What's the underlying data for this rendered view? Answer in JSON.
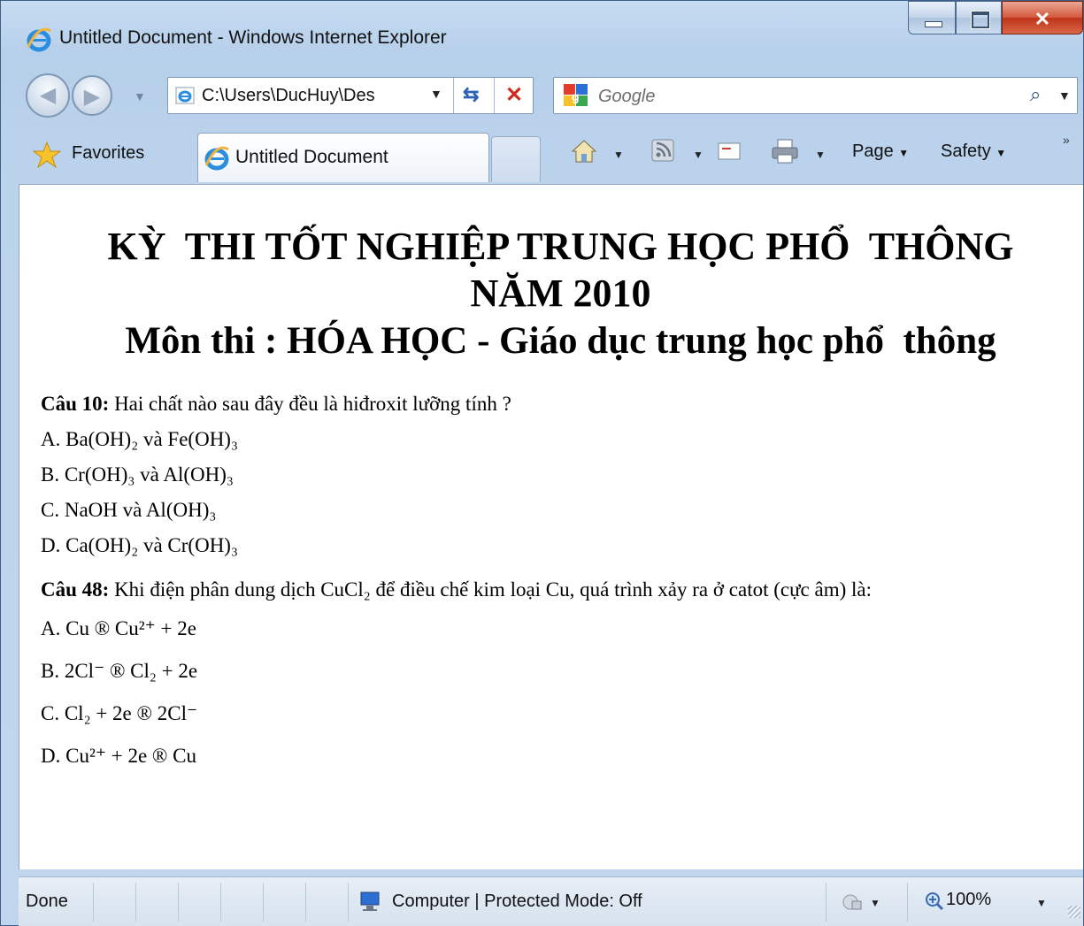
{
  "window": {
    "title": "Untitled Document - Windows Internet Explorer"
  },
  "address": {
    "url": "C:\\Users\\DucHuy\\Des"
  },
  "search": {
    "placeholder": "Google"
  },
  "tabs": {
    "favorites_label": "Favorites",
    "active_tab_label": "Untitled Document"
  },
  "commands": {
    "page_label": "Page",
    "safety_label": "Safety"
  },
  "document": {
    "heading_line1": "KỲ  THI TỐT NGHIỆP TRUNG HỌC PHỔ  THÔNG",
    "heading_line2": "NĂM 2010",
    "heading_line3": "Môn thi : HÓA HỌC - Giáo dục trung học phổ  thông",
    "q10": {
      "label": "Câu 10:",
      "text": " Hai chất nào sau đây đều là hiđroxit lưỡng tính ?",
      "options": [
        "A. Ba(OH)₂ và Fe(OH)₃",
        "B. Cr(OH)₃ và Al(OH)₃",
        "C. NaOH và Al(OH)₃",
        "D. Ca(OH)₂ và Cr(OH)₃"
      ]
    },
    "q48": {
      "label": "Câu 48:",
      "text": " Khi điện phân dung dịch CuCl₂ để điều chế kim loại Cu, quá trình xảy ra ở catot (cực âm) là:",
      "options": [
        "A. Cu ® Cu²⁺ + 2e",
        "B. 2Cl⁻ ® Cl₂ + 2e",
        "C. Cl₂ + 2e ® 2Cl⁻",
        "D. Cu²⁺ + 2e ® Cu"
      ]
    }
  },
  "status": {
    "text": "Done",
    "zone": "Computer | Protected Mode: Off",
    "zoom": "100%"
  },
  "colors": {
    "frame": "#c1d6ee",
    "close_button": "#c8432b"
  }
}
